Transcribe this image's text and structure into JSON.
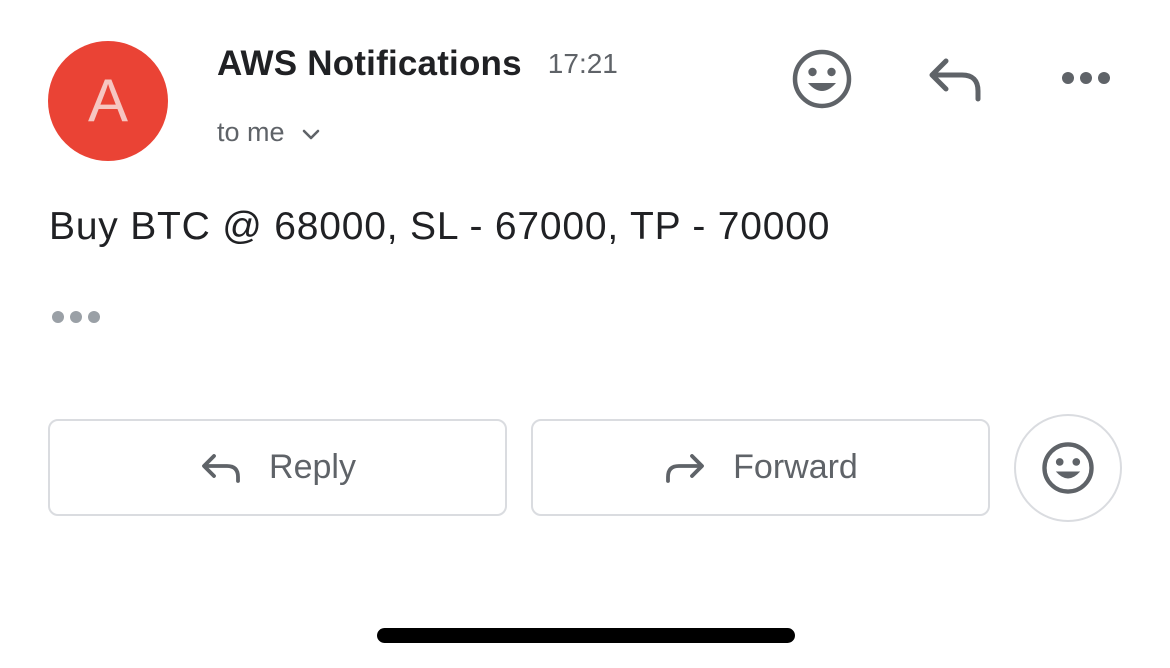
{
  "sender": {
    "avatar_letter": "A",
    "avatar_color": "#ea4335",
    "name": "AWS Notifications",
    "time": "17:21",
    "recipient": "to me"
  },
  "header_actions": {
    "emoji_icon": "smiley-face-icon",
    "reply_icon": "reply-arrow-icon",
    "more_icon": "more-horizontal-icon"
  },
  "message": {
    "body": "Buy BTC @ 68000, SL - 67000, TP - 70000"
  },
  "actions": {
    "reply_label": "Reply",
    "forward_label": "Forward"
  },
  "colors": {
    "text_primary": "#202124",
    "text_secondary": "#5f6368",
    "border": "#dadce0"
  }
}
